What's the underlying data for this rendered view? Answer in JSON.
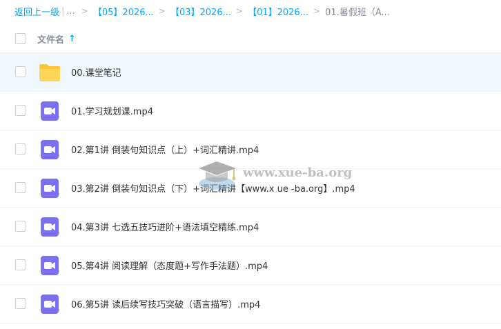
{
  "breadcrumb": {
    "back_label": "返回上一级",
    "ellipsis": "...",
    "items": [
      "【05】2026...",
      "【03】2026...",
      "【01】2026..."
    ],
    "current": "01.暑假班（A..."
  },
  "header": {
    "column_name_label": "文件名",
    "sort_icon": "arrow-up-icon"
  },
  "files": [
    {
      "name": "00.课堂笔记",
      "type": "folder-icon"
    },
    {
      "name": "01.学习规划课.mp4",
      "type": "video-icon"
    },
    {
      "name": "02.第1讲 倒装句知识点（上）+词汇精讲.mp4",
      "type": "video-icon"
    },
    {
      "name": "03.第2讲 倒装句知识点（下）+词汇精讲【www.x ue -ba.org】.mp4",
      "type": "video-icon"
    },
    {
      "name": "04.第3讲 七选五技巧进阶+语法填空精练.mp4",
      "type": "video-icon"
    },
    {
      "name": "05.第4讲 阅读理解（态度题+写作手法题）.mp4",
      "type": "video-icon"
    },
    {
      "name": "06.第5讲 读后续写技巧突破（语言描写）.mp4",
      "type": "video-icon"
    }
  ],
  "watermark": {
    "text": "www.xue-ba.org"
  },
  "colors": {
    "accent": "#06a7ff",
    "folder": "#ffd04b",
    "video": "#7b6ff0",
    "selected_row": "#f1f8fe"
  }
}
